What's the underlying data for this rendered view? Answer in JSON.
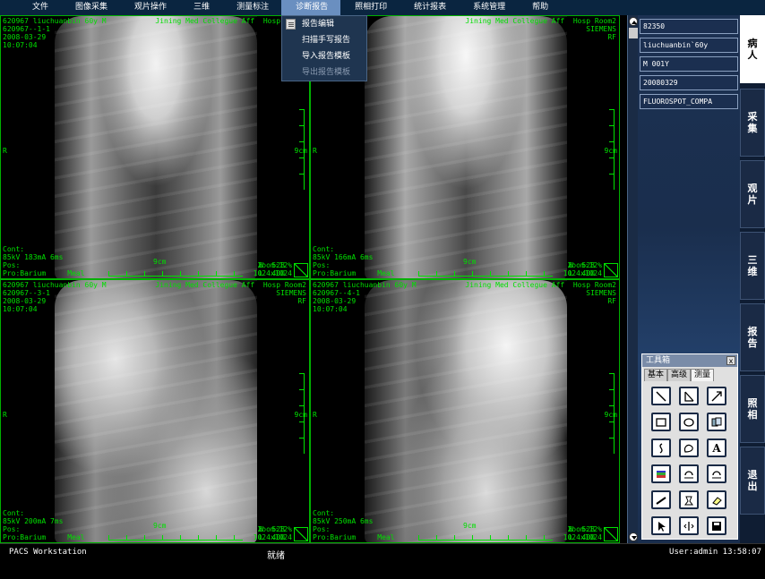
{
  "menu": [
    {
      "label": "文件"
    },
    {
      "label": "图像采集"
    },
    {
      "label": "观片操作"
    },
    {
      "label": "三维"
    },
    {
      "label": "测量标注"
    },
    {
      "label": "诊断报告",
      "active": true
    },
    {
      "label": "照相打印"
    },
    {
      "label": "统计报表"
    },
    {
      "label": "系统管理"
    },
    {
      "label": "帮助"
    }
  ],
  "dropdown": [
    {
      "label": "报告编辑",
      "icon": "report-edit-icon",
      "disabled": false
    },
    {
      "label": "扫描手写报告",
      "disabled": false
    },
    {
      "label": "导入报告模板",
      "disabled": false
    },
    {
      "label": "导出报告模板",
      "disabled": true
    }
  ],
  "panes": [
    {
      "header_left": "620967 liuchuanbin 60y M\n620967--1-1\n2008-03-29\n10:07:04",
      "header_right": "Jining Med Collegue Aff  Hosp Room2\nS",
      "side_left": "R",
      "scale_right": "9cm",
      "scale_center": "9cm",
      "footer_left": "Cont:\n85kV 183mA 6ms\nPos:\nPro:Barium     Meal",
      "footer_right": "Zoom:12%\n1024x1024",
      "wl": "W  528\nL  400"
    },
    {
      "header_left": "",
      "header_right": "Jining Med Collegue Aff  Hosp Room2\nSIEMENS\nRF",
      "side_left": "R",
      "scale_right": "9cm",
      "scale_center": "9cm",
      "footer_left": "Cont:\n85kV 166mA 6ms\nPos:\nPro:Barium     Meal",
      "footer_right": "Zoom:12%\n1024x1024",
      "wl": "W  528\nL  400"
    },
    {
      "header_left": "620967 liuchuanbin 60y M\n620967--3-1\n2008-03-29\n10:07:04",
      "header_right": "Jining Med Collegue Aff  Hosp Room2\nSIEMENS\nRF",
      "side_left": "R",
      "scale_right": "9cm",
      "scale_center": "9cm",
      "footer_left": "Cont:\n85kV 200mA 7ms\nPos:\nPro:Barium     Meal",
      "footer_right": "Zoom:12%\n1024x1024",
      "wl": "W  528\nL  400"
    },
    {
      "header_left": "620967 liuchuanbin 60y M\n620967--4-1\n2008-03-29\n10:07:04",
      "header_right": "Jining Med Collegue Aff  Hosp Room2\nSIEMENS\nRF",
      "side_left": "R",
      "scale_right": "9cm",
      "scale_center": "9cm",
      "footer_left": "Cont:\n85kV 250mA 6ms\nPos:\nPro:Barium     Meal",
      "footer_right": "Zoom:12%\n1024x1024",
      "wl": "W  528\nL  400"
    }
  ],
  "patient_info": [
    "82350",
    "liuchuanbin`60y",
    "M 001Y",
    "20080329",
    "FLUOROSPOT_COMPA"
  ],
  "side_tabs": [
    {
      "label": "病人",
      "active": true
    },
    {
      "label": "采集"
    },
    {
      "label": "观片"
    },
    {
      "label": "三维"
    },
    {
      "label": "报告"
    },
    {
      "label": "照相"
    },
    {
      "label": "退出"
    }
  ],
  "toolbox": {
    "title": "工具箱",
    "close": "x",
    "tabs": [
      {
        "label": "基本"
      },
      {
        "label": "高级"
      },
      {
        "label": "测量",
        "active": true
      }
    ],
    "tools": [
      "line-icon",
      "angle-icon",
      "arrow-icon",
      "rectangle-icon",
      "ellipse-icon",
      "copy-icon",
      "curve-icon",
      "freehand-area-icon",
      "text-icon",
      "color-bar-icon",
      "rotate-left-icon",
      "rotate-right-icon",
      "ruler-icon",
      "stamp-icon",
      "eraser-icon",
      "pointer-icon",
      "split-icon",
      "save-icon"
    ],
    "text_tool_label": "A"
  },
  "status": {
    "left": "PACS Workstation",
    "center": "就绪",
    "right": "User:admin  13:58:07"
  },
  "colors": {
    "overlay": "#00e000",
    "menubar": "#0a2540",
    "active_menu": "#6a8fc0"
  }
}
